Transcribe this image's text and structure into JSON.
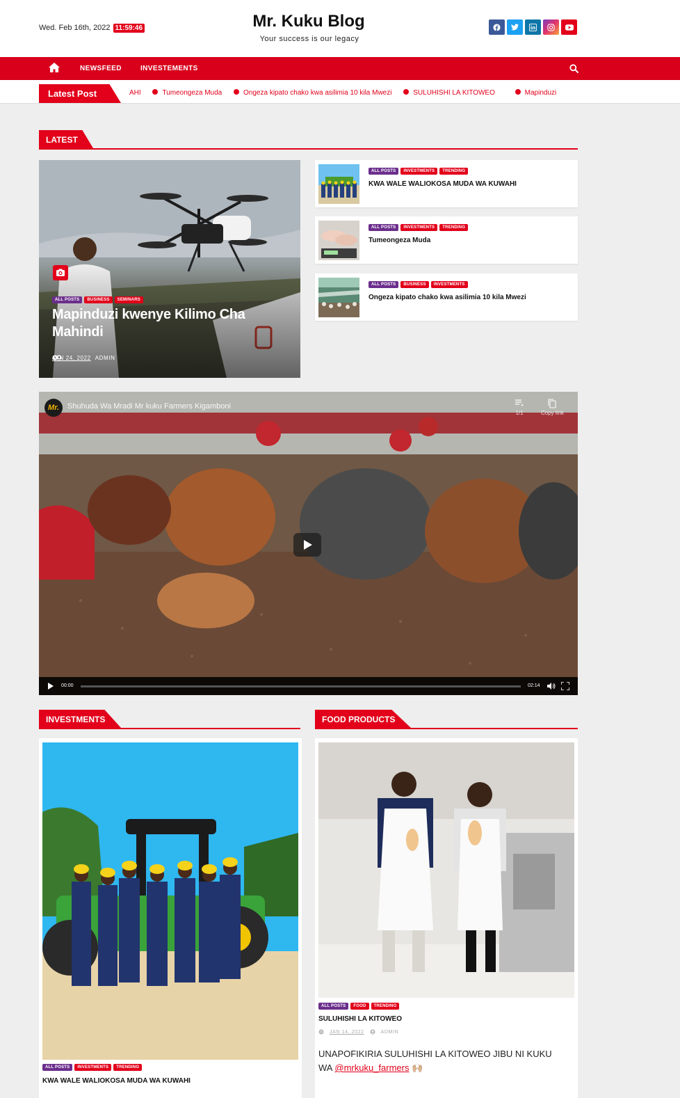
{
  "header": {
    "date": "Wed. Feb 16th, 2022",
    "time": "11:59:46",
    "site_title": "Mr. Kuku Blog",
    "tagline": "Your success is our legacy",
    "socials": [
      {
        "name": "facebook-icon",
        "glyph": "f",
        "color": "#3b5998"
      },
      {
        "name": "twitter-icon",
        "glyph": "t",
        "color": "#1da1f2"
      },
      {
        "name": "linkedin-icon",
        "glyph": "in",
        "color": "#0e76a8"
      },
      {
        "name": "instagram-icon",
        "glyph": "◎",
        "color": "#c13584"
      },
      {
        "name": "youtube-icon",
        "glyph": "▶",
        "color": "#e2001a"
      }
    ]
  },
  "nav": {
    "items": [
      {
        "label": "NEWSFEED"
      },
      {
        "label": "INVESTEMENTS"
      }
    ]
  },
  "ticker": {
    "label": "Latest Post",
    "items": [
      "AHI",
      "Tumeongeza Muda",
      "Ongeza kipato chako kwa asilimia 10 kila Mwezi",
      "SULUHISHI LA KITOWEO",
      "Mapinduzi"
    ]
  },
  "latest": {
    "heading": "LATEST",
    "hero": {
      "cats": [
        "ALL POSTS",
        "BUSINESS",
        "SEMINARS"
      ],
      "title": "Mapinduzi kwenye Kilimo Cha Mahindi",
      "date": "JAN 24, 2022",
      "author": "ADMIN"
    },
    "side": [
      {
        "cats": [
          "ALL POSTS",
          "INVESTMENTS",
          "TRENDING"
        ],
        "title": "KWA WALE WALIOKOSA MUDA WA KUWAHI"
      },
      {
        "cats": [
          "ALL POSTS",
          "INVESTMENTS",
          "TRENDING"
        ],
        "title": "Tumeongeza Muda"
      },
      {
        "cats": [
          "ALL POSTS",
          "BUSINESS",
          "INVESTMENTS"
        ],
        "title": "Ongeza kipato chako kwa asilimia 10 kila Mwezi"
      }
    ]
  },
  "video": {
    "logo": "Mr.",
    "title": "Shuhuda Wa Mradi Mr kuku Farmers Kigamboni",
    "playlist_count": "1/1",
    "copy_label": "Copy link",
    "current_time": "00:00",
    "duration": "02:14",
    "progress": 0
  },
  "investments": {
    "heading": "INVESTMENTS",
    "cats": [
      "ALL POSTS",
      "INVESTMENTS",
      "TRENDING"
    ],
    "title": "KWA WALE WALIOKOSA MUDA WA KUWAHI"
  },
  "food": {
    "heading": "FOOD PRODUCTS",
    "cats": [
      "ALL POSTS",
      "FOOD",
      "TRENDING"
    ],
    "title": "SULUHISHI LA KITOWEO",
    "date": "JAN 14, 2022",
    "author": "ADMIN",
    "excerpt": "UNAPOFIKIRIA SULUHISHI LA KITOWEO JIBU NI KUKU WA",
    "mention": "@mrkuku_farmers",
    "emoji": "🙌🏼"
  },
  "colors": {
    "accent": "#e2001a",
    "category_purple": "#6b2e8c"
  }
}
